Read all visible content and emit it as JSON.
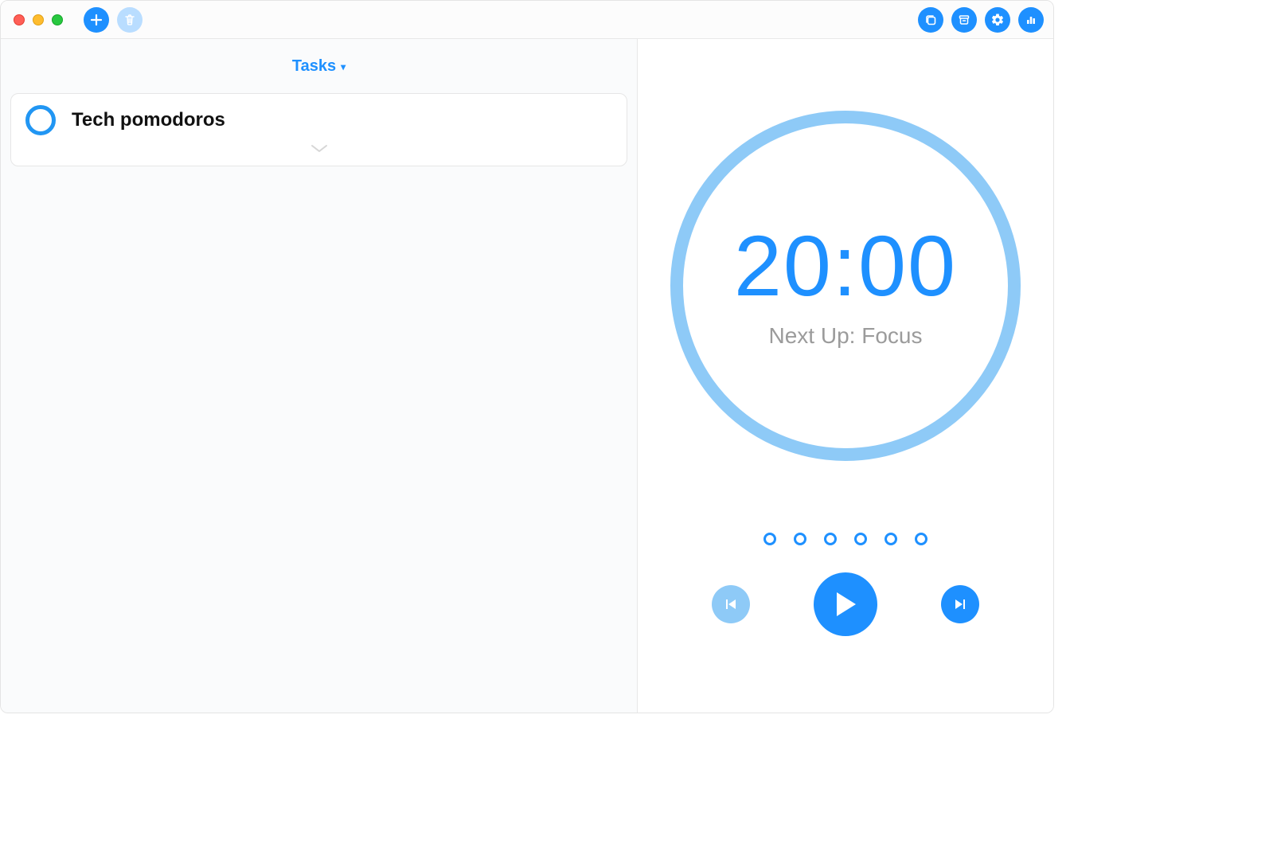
{
  "colors": {
    "accent": "#1e90ff",
    "accent_light": "#8ecaf7",
    "muted_blue": "#b9ddff"
  },
  "titlebar": {
    "left_icons": {
      "add": "plus-icon",
      "delete": "trash-icon"
    },
    "right_icons": [
      "panel-icon",
      "archive-icon",
      "gear-icon",
      "bar-chart-icon"
    ]
  },
  "tasks": {
    "header_label": "Tasks",
    "items": [
      {
        "title": "Tech pomodoros",
        "completed": false
      }
    ]
  },
  "timer": {
    "value": "20:00",
    "label": "Next Up: Focus",
    "progress_count": 6,
    "controls": {
      "prev": "skip-back-icon",
      "play": "play-icon",
      "next": "skip-forward-icon"
    }
  }
}
